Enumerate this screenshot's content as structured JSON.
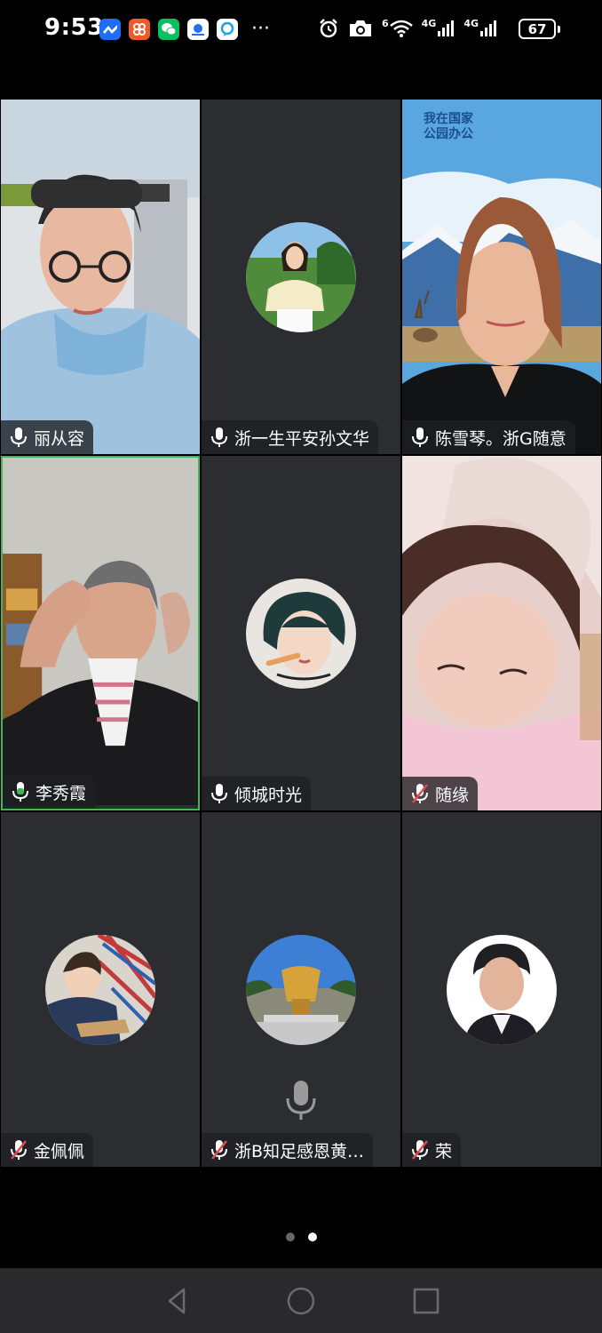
{
  "status_bar": {
    "time": "9:53",
    "app_icons": [
      "feishu-icon",
      "taobao-icon",
      "wechat-icon",
      "tencent-meeting-icon",
      "chat-bubble-icon"
    ],
    "more": "···",
    "wifi_badge": "6",
    "network_1": "4G",
    "network_2": "4G",
    "battery": "67"
  },
  "participants": [
    {
      "name": "丽从容",
      "mic": "on",
      "video": true
    },
    {
      "name": "浙一生平安孙文华",
      "mic": "on",
      "video": false
    },
    {
      "name": "陈雪琴。浙G随意",
      "mic": "on",
      "video": true
    },
    {
      "name": "李秀霞",
      "mic": "speaking",
      "video": true,
      "active_speaker": true
    },
    {
      "name": "倾城时光",
      "mic": "on",
      "video": false
    },
    {
      "name": "随缘",
      "mic": "muted",
      "video": true
    },
    {
      "name": "金佩佩",
      "mic": "muted",
      "video": false
    },
    {
      "name": "浙B知足感恩黄…",
      "mic": "muted",
      "video": false
    },
    {
      "name": "荣",
      "mic": "muted",
      "video": false
    }
  ],
  "backdrop_text": {
    "line1": "我在国家",
    "line2": "公园办公"
  },
  "pagination": {
    "current": 2,
    "total": 2
  },
  "colors": {
    "tile_bg": "#2b2d31",
    "active_border": "#3fb950",
    "muted_red": "#e5484d",
    "speaking_green": "#3fb950"
  }
}
